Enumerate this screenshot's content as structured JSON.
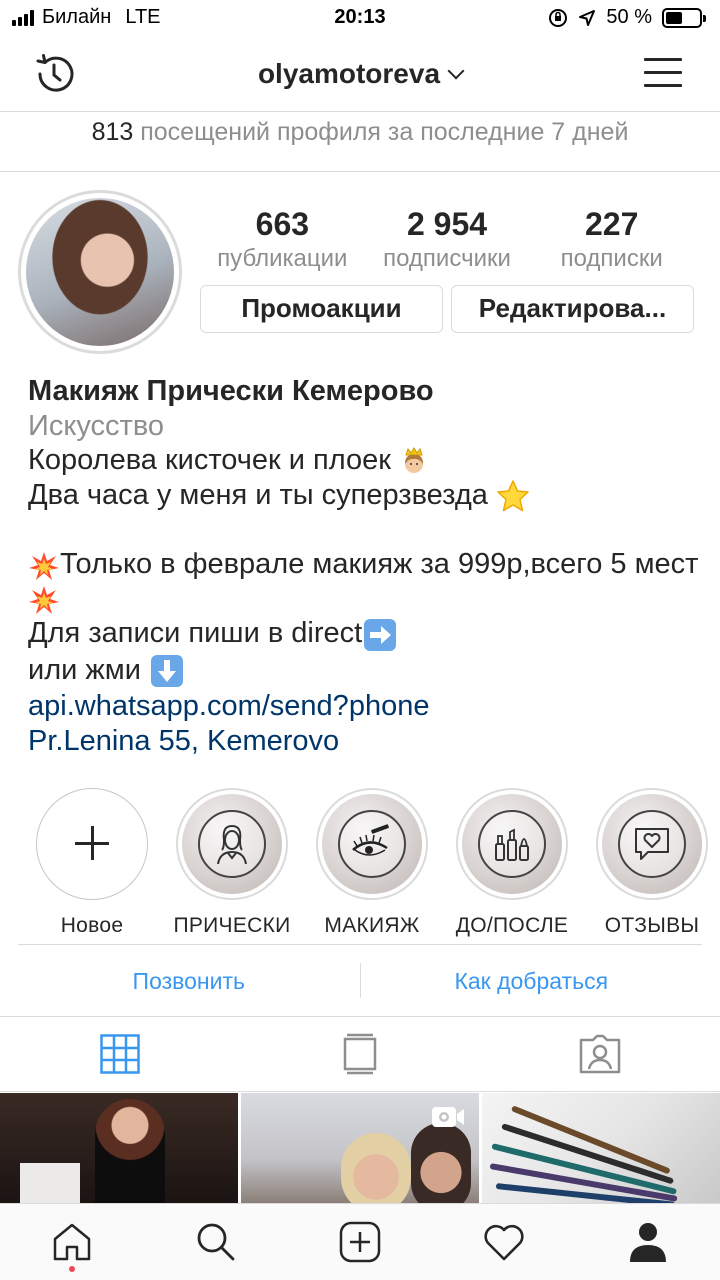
{
  "status_bar": {
    "carrier": "Билайн",
    "network": "LTE",
    "time": "20:13",
    "battery": "50 %",
    "battery_level": 0.5
  },
  "header": {
    "username": "olyamotoreva",
    "icons": [
      "history-icon",
      "chevron-down-icon",
      "menu-icon"
    ]
  },
  "visits": {
    "count": "813",
    "text": " посещений профиля за последние 7 дней"
  },
  "stats": [
    {
      "value": "663",
      "label": "публикации"
    },
    {
      "value": "2 954",
      "label": "подписчики"
    },
    {
      "value": "227",
      "label": "подписки"
    }
  ],
  "buttons": {
    "promo": "Промоакции",
    "edit": "Редактирова..."
  },
  "bio": {
    "name": "Макияж Прически Кемерово",
    "category": "Искусство",
    "line1": "Королева кисточек и плоек",
    "line2": "Два часа у меня и ты суперзвезда",
    "line3": "Только в феврале макияж за 999р,всего 5 мест",
    "line4": "Для записи пиши в direct",
    "line5": "или жми",
    "link": "api.whatsapp.com/send?phone",
    "address": "Pr.Lenina 55, Kemerovo"
  },
  "highlights": [
    {
      "label": "Новое",
      "icon": "plus-icon"
    },
    {
      "label": "ПРИЧЕСКИ",
      "icon": "woman-icon"
    },
    {
      "label": "МАКИЯЖ",
      "icon": "eye-mascara-icon"
    },
    {
      "label": "ДО/ПОСЛЕ",
      "icon": "cosmetics-icon"
    },
    {
      "label": "ОТЗЫВЫ",
      "icon": "heart-message-icon"
    }
  ],
  "contact": {
    "call": "Позвонить",
    "directions": "Как добраться"
  },
  "colors": {
    "link_blue": "#3897f0",
    "bio_link": "#003569",
    "muted": "#8e8e8e",
    "text": "#262626",
    "border": "#dbdbdb",
    "notification_dot": "#ed4956"
  }
}
